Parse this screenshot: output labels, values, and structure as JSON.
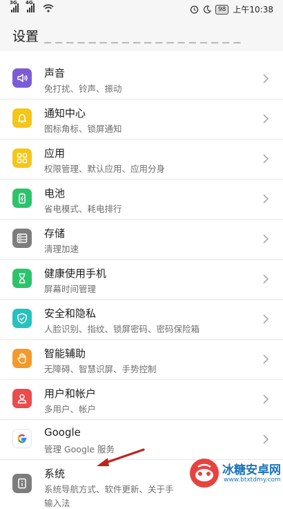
{
  "status_bar": {
    "sim1": "3G",
    "sim2": "4G",
    "battery": "98",
    "time": "上午10:38"
  },
  "header": {
    "title": "设置"
  },
  "items": [
    {
      "title": "声音",
      "subtitle": "免打扰、铃声、振动",
      "icon": "speaker-icon",
      "color": "#7b5cd6"
    },
    {
      "title": "通知中心",
      "subtitle": "图标角标、锁屏通知",
      "icon": "bell-icon",
      "color": "#f5c518"
    },
    {
      "title": "应用",
      "subtitle": "权限管理、默认应用、应用分身",
      "icon": "apps-grid-icon",
      "color": "#f5c518"
    },
    {
      "title": "电池",
      "subtitle": "省电模式、耗电排行",
      "icon": "battery-icon",
      "color": "#2bc46c"
    },
    {
      "title": "存储",
      "subtitle": "清理加速",
      "icon": "storage-icon",
      "color": "#7d7d7d"
    },
    {
      "title": "健康使用手机",
      "subtitle": "屏幕时间管理",
      "icon": "hourglass-icon",
      "color": "#2bc46c"
    },
    {
      "title": "安全和隐私",
      "subtitle": "人脸识别、指纹、锁屏密码、密码保险箱",
      "icon": "shield-icon",
      "color": "#25c2c0"
    },
    {
      "title": "智能辅助",
      "subtitle": "无障碍、智慧识屏、手势控制",
      "icon": "hand-icon",
      "color": "#f39a2b"
    },
    {
      "title": "用户和帐户",
      "subtitle": "多用户、帐户",
      "icon": "user-icon",
      "color": "#ea4b4b"
    },
    {
      "title": "Google",
      "subtitle": "管理 Google 服务",
      "icon": "google-icon",
      "color": "#ffffff"
    },
    {
      "title": "系统",
      "subtitle": "系统导航方式、软件更新、关于手",
      "subtitle2": "输入法",
      "icon": "system-info-icon",
      "color": "#7d7d7d"
    }
  ],
  "watermark": {
    "name": "冰糖安卓网",
    "url": "www.btxtdmy.com"
  }
}
